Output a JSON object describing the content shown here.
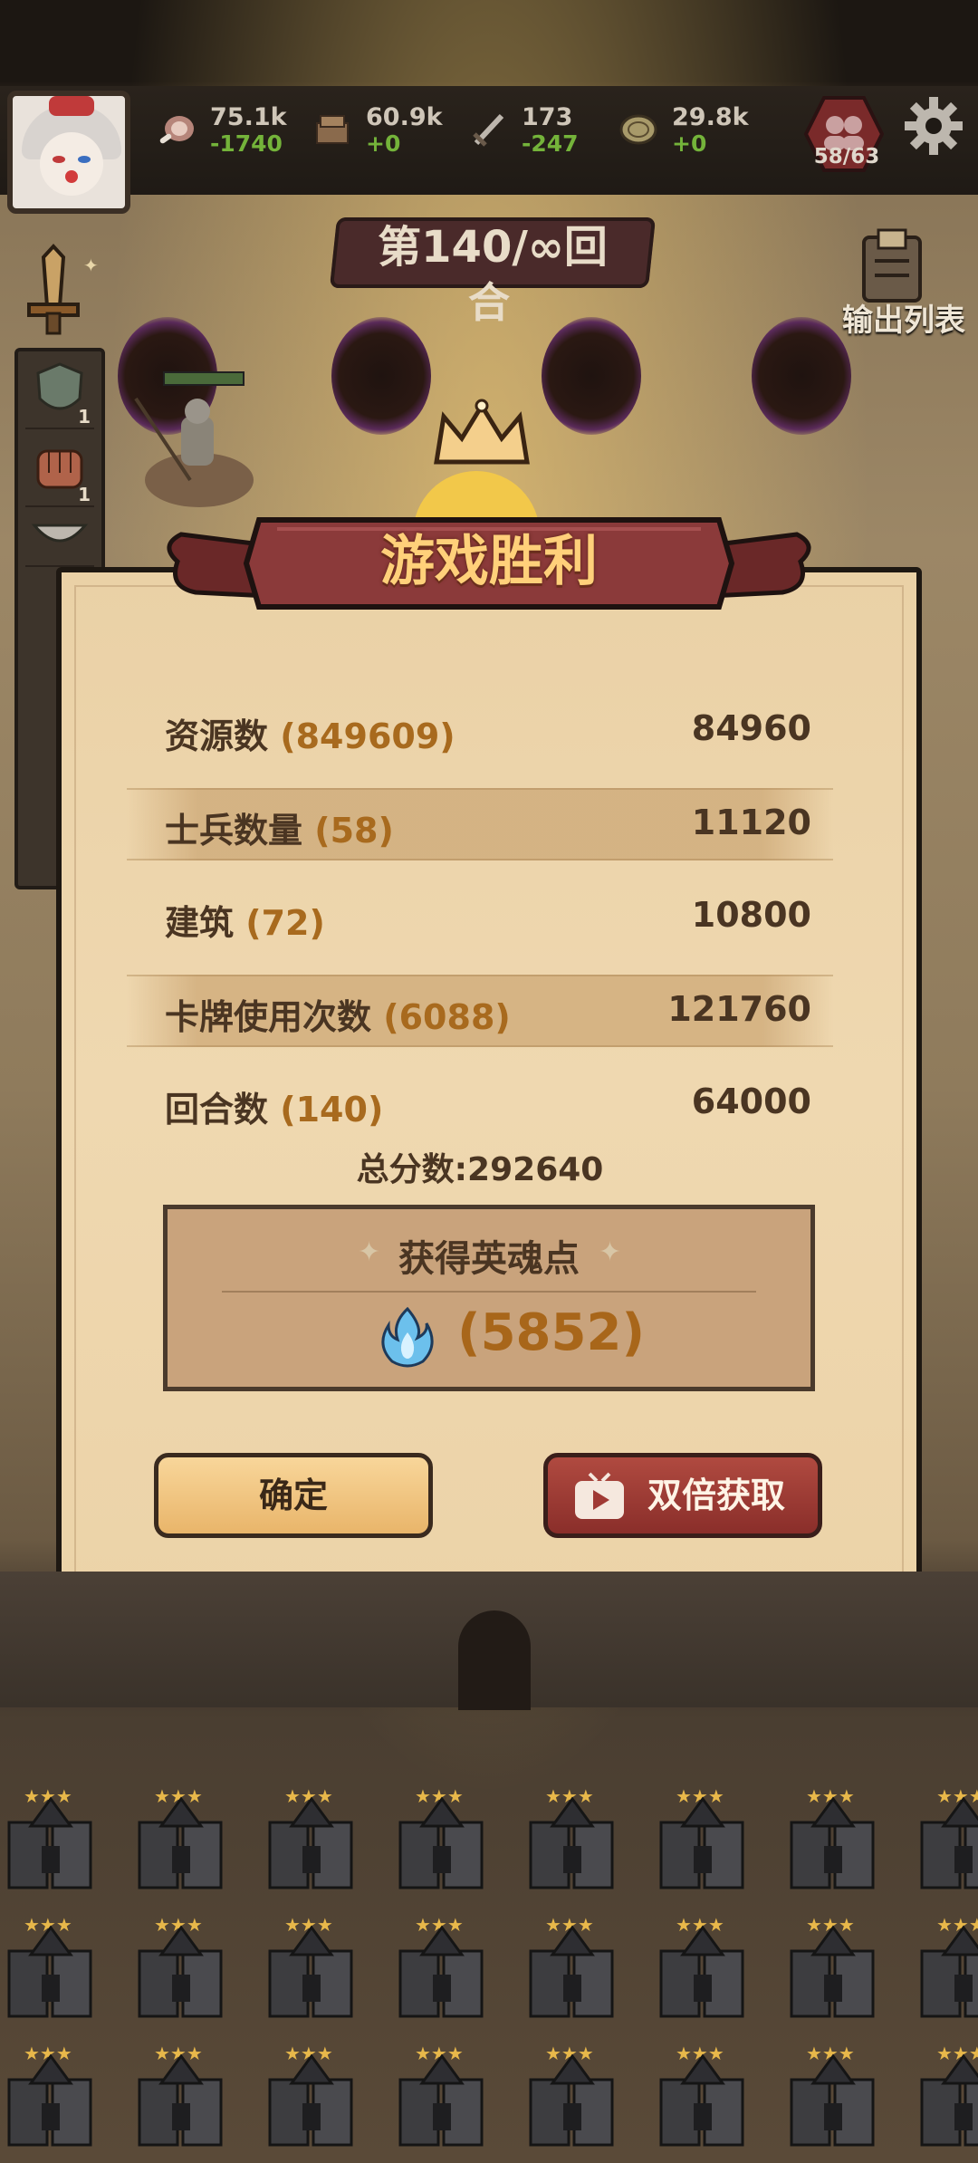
{
  "resources": [
    {
      "icon": "meat-icon",
      "value": "75.1k",
      "delta": "-1740"
    },
    {
      "icon": "wood-icon",
      "value": "60.9k",
      "delta": "+0"
    },
    {
      "icon": "sword-icon",
      "value": "173",
      "delta": "-247"
    },
    {
      "icon": "coin-icon",
      "value": "29.8k",
      "delta": "+0"
    }
  ],
  "population": "58/63",
  "round": {
    "line1": "第140/∞回",
    "line2": "合"
  },
  "output_list_label": "输出列表",
  "sidebar_counts": [
    "1",
    "1"
  ],
  "dialog": {
    "title": "游戏胜利",
    "rows": [
      {
        "label": "资源数",
        "count": "(849609)",
        "value": "84960"
      },
      {
        "label": "士兵数量",
        "count": "(58)",
        "value": "11120"
      },
      {
        "label": "建筑",
        "count": "(72)",
        "value": "10800"
      },
      {
        "label": "卡牌使用次数",
        "count": "(6088)",
        "value": "121760"
      },
      {
        "label": "回合数",
        "count": "(140)",
        "value": "64000"
      }
    ],
    "total_label": "总分数:",
    "total_value": "292640",
    "soul_title": "获得英魂点",
    "soul_value": "(5852)",
    "confirm_label": "确定",
    "double_label": "双倍获取"
  },
  "colors": {
    "accent": "#a86a1e",
    "ribbon": "#8b3a3a",
    "title_text": "#ffd07a",
    "positive_delta": "#74b33a"
  }
}
